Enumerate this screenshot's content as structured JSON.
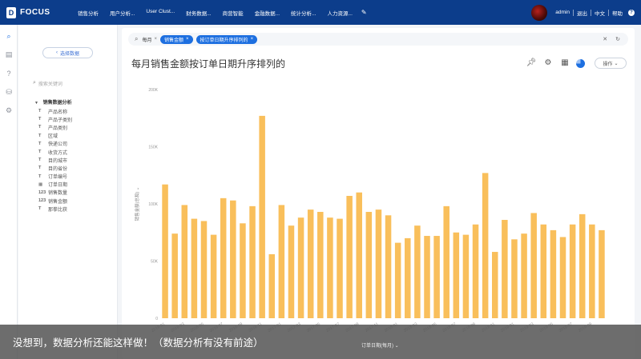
{
  "nav": {
    "logo_text": "FOCUS",
    "logo_mark": "D",
    "items": [
      "销售分析",
      "用户分析...",
      "User Clust...",
      "财务数据...",
      "商营智能",
      "金融数据...",
      "统计分析...",
      "人力资源..."
    ],
    "edit_icon": "edit-icon",
    "username": "admin",
    "logout": "退出",
    "language": "中文",
    "help": "帮助"
  },
  "rail": {
    "icons": [
      "search-icon",
      "document-icon",
      "help-icon",
      "database-icon",
      "settings-icon"
    ]
  },
  "sidepanel": {
    "select_data_label": "选择数据",
    "search_placeholder": "搜索关键词",
    "root_label": "销售数据分析",
    "fields": [
      {
        "type": "T",
        "name": "产品名称"
      },
      {
        "type": "T",
        "name": "产品子类别"
      },
      {
        "type": "T",
        "name": "产品类别"
      },
      {
        "type": "T",
        "name": "区域"
      },
      {
        "type": "T",
        "name": "快递公司"
      },
      {
        "type": "T",
        "name": "收货方式"
      },
      {
        "type": "T",
        "name": "目的城市"
      },
      {
        "type": "T",
        "name": "目的省份"
      },
      {
        "type": "T",
        "name": "订单编号"
      },
      {
        "type": "▦",
        "name": "订单日期"
      },
      {
        "type": "123",
        "name": "销售数量"
      },
      {
        "type": "123",
        "name": "销售金额"
      },
      {
        "type": "T",
        "name": "那拳比获"
      }
    ]
  },
  "query": {
    "tokens": [
      {
        "label": "每月",
        "chip": false
      },
      {
        "label": "销售金额",
        "chip": true
      },
      {
        "label": "按订单日期升序排列的",
        "chip": true
      }
    ],
    "clear_icon": "close-icon",
    "refresh_icon": "refresh-icon"
  },
  "main": {
    "title": "每月销售金额按订单日期升序排列的",
    "tool_icons": [
      "pin-icon",
      "gear-icon",
      "table-icon",
      "pie-chart-icon"
    ],
    "ops_label": "操作"
  },
  "chart_data": {
    "type": "bar",
    "ylabel": "销售金额(总和)",
    "xlabel": "订单日期(每月)",
    "ylim": [
      0,
      200000
    ],
    "yticks": [
      "0",
      "50K",
      "100K",
      "150K",
      "200K"
    ],
    "color": "#f9bf5b",
    "values": [
      117000,
      74000,
      99000,
      87000,
      85000,
      73000,
      105000,
      103000,
      83000,
      98000,
      177000,
      56000,
      99000,
      81000,
      88000,
      95000,
      93000,
      88000,
      87000,
      107000,
      110000,
      93000,
      95000,
      90000,
      66000,
      70000,
      81000,
      72000,
      72000,
      98000,
      75000,
      73000,
      82000,
      127000,
      58000,
      86000,
      69000,
      74000,
      92000,
      82000,
      77000,
      71000,
      82000,
      91000,
      82000,
      77000
    ],
    "categories": [
      "2016-01",
      "2016-02",
      "2016-03",
      "2016-04",
      "2016-05",
      "2016-06",
      "2016-07",
      "2016-08",
      "2016-09",
      "2016-10",
      "2016-11",
      "2016-12",
      "2017-01",
      "2017-02",
      "2017-03",
      "2017-04",
      "2017-05",
      "2017-06",
      "2017-07",
      "2017-08",
      "2017-09",
      "2017-10",
      "2017-11",
      "2017-12",
      "2018-01",
      "2018-02",
      "2018-03",
      "2018-04",
      "2018-05",
      "2018-06",
      "2018-07",
      "2018-08",
      "2018-09",
      "2018-10",
      "2018-11",
      "2018-12",
      "2019-01",
      "2019-02",
      "2019-03",
      "2019-04",
      "2019-05",
      "2019-06",
      "2019-07",
      "2019-08",
      "2019-09",
      "2019-10"
    ]
  },
  "caption": {
    "text": "没想到，数据分析还能这样做！（数据分析有没有前途）"
  }
}
